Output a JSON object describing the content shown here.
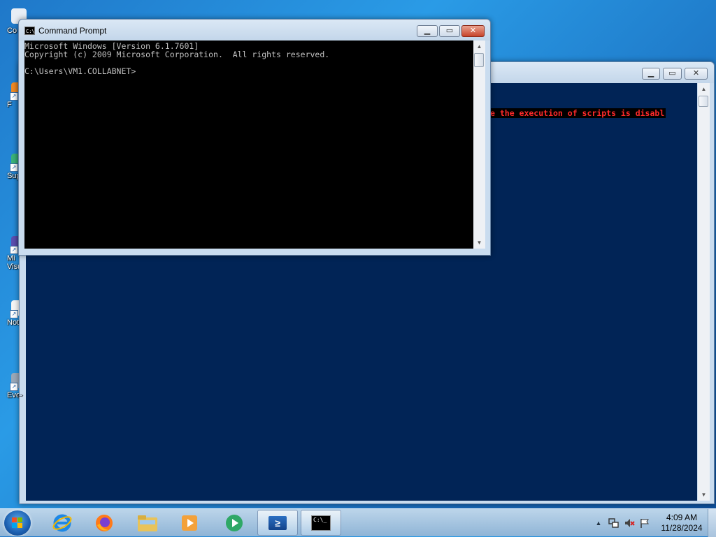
{
  "desktop": {
    "icons": [
      {
        "label": "Co",
        "color": "#e8eef5"
      },
      {
        "label": "F",
        "color": "#f08a24"
      },
      {
        "label": "Sup",
        "color": "#3bb27a"
      },
      {
        "label": "Mi\nVisu",
        "color": "#5b4fb0"
      },
      {
        "label": "Not",
        "color": "#f5f5f5"
      },
      {
        "label": "Eve",
        "color": "#9aa8b8"
      }
    ]
  },
  "powershell": {
    "error_text": "e the execution of scripts is disabl",
    "background": "#012456",
    "error_color": "#ff2a2a",
    "minimize_label": "▁",
    "maximize_label": "▭",
    "close_label": "✕"
  },
  "cmd": {
    "title": "Command Prompt",
    "icon_text": "C:\\",
    "lines": [
      "Microsoft Windows [Version 6.1.7601]",
      "Copyright (c) 2009 Microsoft Corporation.  All rights reserved.",
      "",
      "C:\\Users\\VM1.COLLABNET>"
    ],
    "minimize_label": "▁",
    "maximize_label": "▭",
    "close_label": "✕"
  },
  "scroll": {
    "up_arrow": "▲",
    "down_arrow": "▼"
  },
  "taskbar": {
    "pinned": [
      "internet-explorer",
      "firefox",
      "file-explorer",
      "media-player",
      "media-center",
      "powershell",
      "command-prompt"
    ],
    "cmd_icon_text": "C:\\_",
    "ps_icon_text": "≥"
  },
  "tray": {
    "show_hidden": "▲",
    "time": "4:09 AM",
    "date": "11/28/2024"
  },
  "cursor": {
    "symbol": "⇔"
  }
}
